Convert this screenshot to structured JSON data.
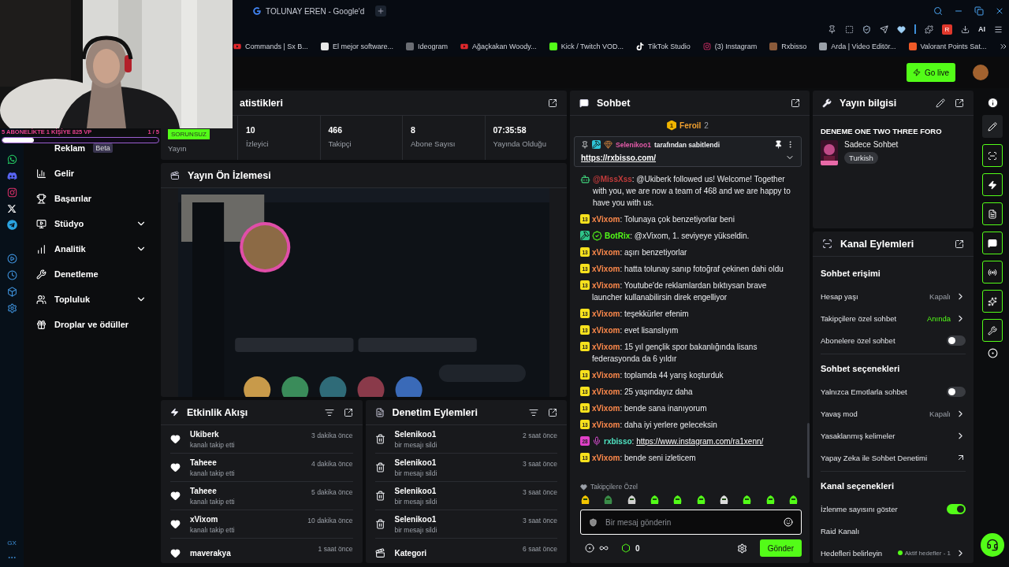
{
  "browser": {
    "tab_title": "TOLUNAY EREN - Google'd",
    "ai_label": "AI",
    "extension_badge": "R",
    "bookmarks": [
      "Commands | Sx B...",
      "El mejor software...",
      "Ideogram",
      "Ağaçkakan Woody...",
      "Kick / Twitch VOD...",
      "TikTok Studio",
      "(3) Instagram",
      "Rxbisso",
      "Arda | Video Editör...",
      "Valorant Points Sat..."
    ],
    "sidebar_label": "GX"
  },
  "stream_overlay": {
    "goal": "5 ABONELİKTE 1 KİŞİYE 825 VP",
    "count": "1 / 5",
    "level": 0.2
  },
  "header": {
    "go_live": "Go live"
  },
  "nav": [
    {
      "label": "Reklam",
      "badge": "Beta",
      "expandable": false
    },
    {
      "label": "Gelir",
      "expandable": false
    },
    {
      "label": "Başarılar",
      "expandable": false
    },
    {
      "label": "Stüdyo",
      "expandable": true
    },
    {
      "label": "Analitik",
      "expandable": true
    },
    {
      "label": "Denetleme",
      "expandable": false
    },
    {
      "label": "Topluluk",
      "expandable": true
    },
    {
      "label": "Droplar ve ödüller",
      "expandable": false
    }
  ],
  "stats": {
    "title": "atistikleri",
    "status_badge": "SORUNSUZ",
    "status_label": "Yayın",
    "items": [
      {
        "value": "10",
        "label": "İzleyici"
      },
      {
        "value": "466",
        "label": "Takipçi"
      },
      {
        "value": "8",
        "label": "Abone Sayısı"
      },
      {
        "value": "07:35:58",
        "label": "Yayında Olduğu"
      }
    ]
  },
  "preview": {
    "title": "Yayın Ön İzlemesi"
  },
  "activity": {
    "title": "Etkinlik Akışı",
    "items": [
      {
        "name": "Ukiberk",
        "action": "kanalı takip etti",
        "time": "3 dakika önce"
      },
      {
        "name": "Taheee",
        "action": "kanalı takip etti",
        "time": "4 dakika önce"
      },
      {
        "name": "Taheee",
        "action": "kanalı takip etti",
        "time": "5 dakika önce"
      },
      {
        "name": "xVixom",
        "action": "kanalı takip etti",
        "time": "10 dakika önce"
      },
      {
        "name": "maverakya",
        "time": "1 saat önce"
      }
    ]
  },
  "moderation": {
    "title": "Denetim Eylemleri",
    "items": [
      {
        "kind": "delete",
        "name": "Selenikoo1",
        "action": "bir mesajı sildi",
        "time": "2 saat önce"
      },
      {
        "kind": "delete",
        "name": "Selenikoo1",
        "action": "bir mesajı sildi",
        "time": "3 saat önce"
      },
      {
        "kind": "delete",
        "name": "Selenikoo1",
        "action": "bir mesajı sildi",
        "time": "3 saat önce"
      },
      {
        "kind": "delete",
        "name": "Selenikoo1",
        "action": "bir mesajı sildi",
        "time": "3 saat önce"
      },
      {
        "kind": "category",
        "name": "Kategori",
        "time": "6 saat önce"
      }
    ]
  },
  "chat": {
    "title": "Sohbet",
    "top_chatter": {
      "rank": "1",
      "name": "Feroil",
      "count": "2"
    },
    "pinned": {
      "by": "Selenikoo1",
      "label": "tarafından sabitlendi",
      "link": "https://rxbisso.com/"
    },
    "messages": [
      {
        "badges": [
          {
            "kind": "bot"
          }
        ],
        "user": "@MissXss",
        "color": "#c23b3b",
        "text": ": @Ukiberk followed us! Welcome! Together with you, we are now a team of 468 and we are happy to have you with us."
      },
      {
        "badges": [
          {
            "kind": "sub",
            "label": "13",
            "color": "#f7e11d"
          }
        ],
        "user": "xVixom",
        "color": "#ff8a4c",
        "text": ": Tolunaya çok benzetiyorlar beni"
      },
      {
        "badges": [
          {
            "kind": "mod"
          },
          {
            "kind": "verified"
          }
        ],
        "user": "BotRix",
        "color": "#53fc18",
        "text": ": @xVixom, 1. seviyeye yükseldin."
      },
      {
        "badges": [
          {
            "kind": "sub",
            "label": "13",
            "color": "#f7e11d"
          }
        ],
        "user": "xVixom",
        "color": "#ff8a4c",
        "text": ": aşırı benzetiyorlar"
      },
      {
        "badges": [
          {
            "kind": "sub",
            "label": "13",
            "color": "#f7e11d"
          }
        ],
        "user": "xVixom",
        "color": "#ff8a4c",
        "text": ": hatta tolunay sanıp fotoğraf çekinen dahi oldu"
      },
      {
        "badges": [
          {
            "kind": "sub",
            "label": "13",
            "color": "#f7e11d"
          }
        ],
        "user": "xVixom",
        "color": "#ff8a4c",
        "text": ": Youtube'de reklamlardan bıktıysan brave launcher kullanabilirsin direk engelliyor"
      },
      {
        "badges": [
          {
            "kind": "sub",
            "label": "13",
            "color": "#f7e11d"
          }
        ],
        "user": "xVixom",
        "color": "#ff8a4c",
        "text": ": teşekkürler efenim"
      },
      {
        "badges": [
          {
            "kind": "sub",
            "label": "13",
            "color": "#f7e11d"
          }
        ],
        "user": "xVixom",
        "color": "#ff8a4c",
        "text": ": evet lisanslıyım"
      },
      {
        "badges": [
          {
            "kind": "sub",
            "label": "13",
            "color": "#f7e11d"
          }
        ],
        "user": "xVixom",
        "color": "#ff8a4c",
        "text": ": 15 yıl gençlik spor bakanlığında lisans federasyonda da 6 yıldır"
      },
      {
        "badges": [
          {
            "kind": "sub",
            "label": "13",
            "color": "#f7e11d"
          }
        ],
        "user": "xVixom",
        "color": "#ff8a4c",
        "text": ": toplamda 44 yarış koşturduk"
      },
      {
        "badges": [
          {
            "kind": "sub",
            "label": "13",
            "color": "#f7e11d"
          }
        ],
        "user": "xVixom",
        "color": "#ff8a4c",
        "text": ": 25 yaşındayız daha"
      },
      {
        "badges": [
          {
            "kind": "sub",
            "label": "13",
            "color": "#f7e11d"
          }
        ],
        "user": "xVixom",
        "color": "#ff8a4c",
        "text": ": bende sana inanıyorum"
      },
      {
        "badges": [
          {
            "kind": "sub",
            "label": "13",
            "color": "#f7e11d"
          }
        ],
        "user": "xVixom",
        "color": "#ff8a4c",
        "text": ": daha iyi yerlere geleceksin"
      },
      {
        "badges": [
          {
            "kind": "sub",
            "label": "28",
            "color": "#e040c8"
          },
          {
            "kind": "mic"
          }
        ],
        "user": "rxbisso",
        "color": "#4fe3c1",
        "text": ":",
        "link": "https://www.instagram.com/ra1xenn/"
      },
      {
        "badges": [
          {
            "kind": "sub",
            "label": "13",
            "color": "#f7e11d"
          }
        ],
        "user": "xVixom",
        "color": "#ff8a4c",
        "text": ": bende seni izleticem"
      }
    ],
    "emote_section": "Takipçilere Özel",
    "input_placeholder": "Bir mesaj gönderin",
    "coins": "0",
    "send": "Gönder"
  },
  "stream_info": {
    "title": "Yayın bilgisi",
    "stream_title": "DENEME ONE TWO THREE FORO",
    "category": "Sadece Sohbet",
    "tags": [
      "Turkish"
    ]
  },
  "channel_actions": {
    "title": "Kanal Eylemleri",
    "sections": [
      {
        "title": "Sohbet erişimi",
        "rows": [
          {
            "kind": "value",
            "label": "Hesap yaşı",
            "value": "Kapalı",
            "highlight": false
          },
          {
            "kind": "value",
            "label": "Takipçilere özel sohbet",
            "value": "Anında",
            "highlight": true
          },
          {
            "kind": "toggle",
            "label": "Abonelere özel sohbet",
            "on": false
          }
        ]
      },
      {
        "title": "Sohbet seçenekleri",
        "rows": [
          {
            "kind": "toggle",
            "label": "Yalnızca Emotlarla sohbet",
            "on": false
          },
          {
            "kind": "value",
            "label": "Yavaş mod",
            "value": "Kapalı",
            "highlight": false
          },
          {
            "kind": "link",
            "label": "Yasaklanmış kelimeler"
          },
          {
            "kind": "external",
            "label": "Yapay Zeka ile Sohbet Denetimi"
          }
        ]
      },
      {
        "title": "Kanal seçenekleri",
        "rows": [
          {
            "kind": "toggle",
            "label": "İzlenme sayısını göster",
            "on": true
          },
          {
            "kind": "plain",
            "label": "Raid Kanalı"
          },
          {
            "kind": "goal",
            "label": "Hedefleri belirleyin",
            "value": "Aktif hedefler - 1"
          }
        ]
      }
    ]
  }
}
